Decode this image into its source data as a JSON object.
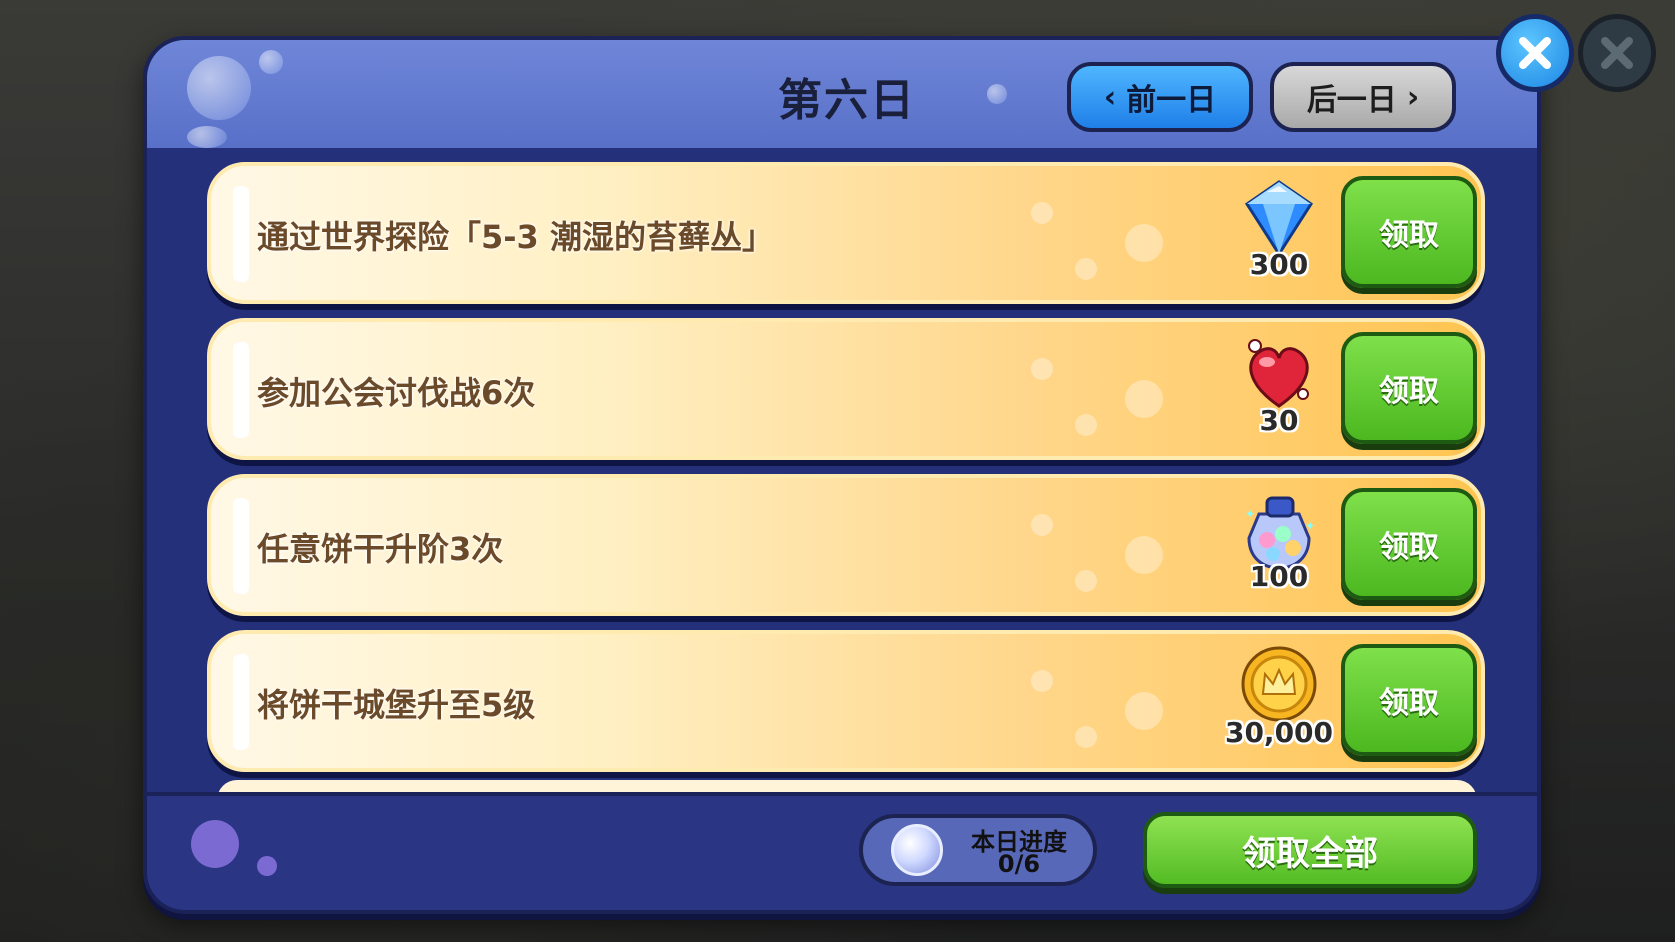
{
  "dialog": {
    "title": "第六日",
    "prev_day_label": "前一日",
    "next_day_label": "后一日"
  },
  "tasks": [
    {
      "text": "通过世界探险「5-3 潮湿的苔藓丛」",
      "reward_icon": "crystal-icon",
      "reward_amount": "300",
      "button_label": "领取"
    },
    {
      "text": "参加公会讨伐战6次",
      "reward_icon": "heart-jelly-icon",
      "reward_amount": "30",
      "button_label": "领取"
    },
    {
      "text": "任意饼干升阶3次",
      "reward_icon": "soulstone-jar-icon",
      "reward_amount": "100",
      "button_label": "领取"
    },
    {
      "text": "将饼干城堡升至5级",
      "reward_icon": "gold-coin-icon",
      "reward_amount": "30,000",
      "button_label": "领取"
    }
  ],
  "footer": {
    "progress_label": "本日进度",
    "progress_value": "0/6",
    "claim_all_label": "领取全部"
  },
  "colors": {
    "panel_bg": "#24307a",
    "claim_green": "#4cb81f",
    "nav_blue": "#1f7fe8",
    "row_gold": "#ffc451"
  }
}
